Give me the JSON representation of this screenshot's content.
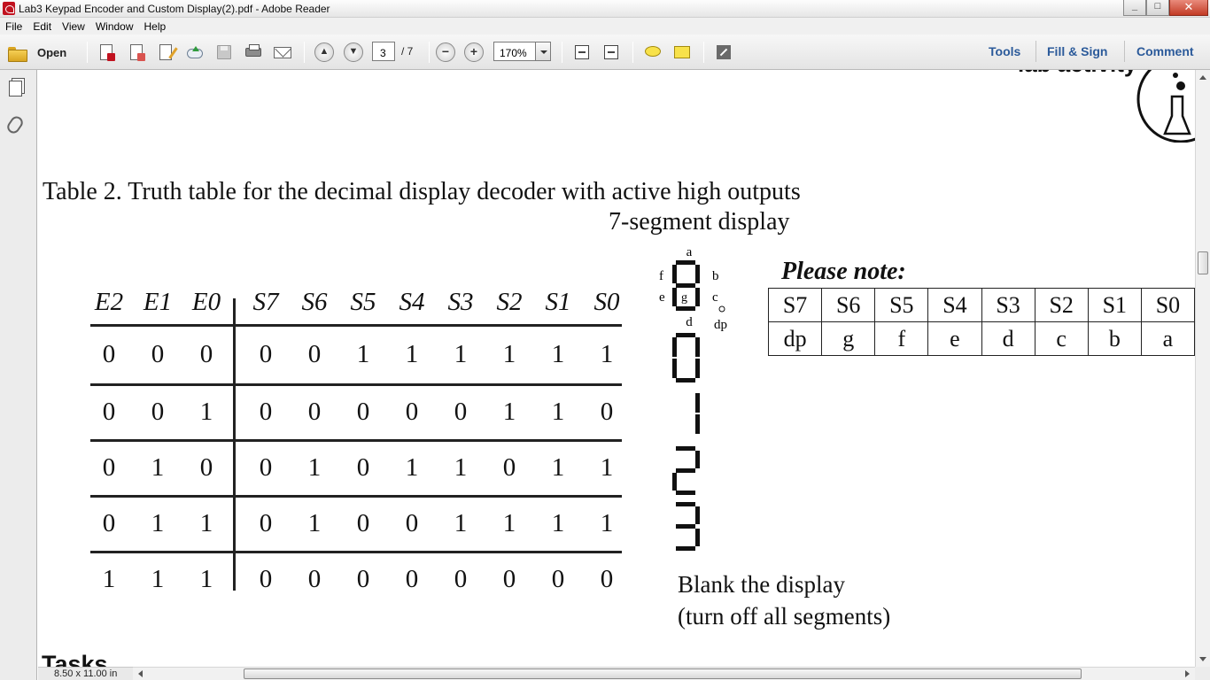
{
  "window": {
    "title": "Lab3 Keypad Encoder and Custom Display(2).pdf - Adobe Reader",
    "minimize_glyph": "_",
    "maximize_glyph": "□",
    "close_glyph": "✕"
  },
  "menu": [
    "File",
    "Edit",
    "View",
    "Window",
    "Help"
  ],
  "toolbar": {
    "open_label": "Open",
    "page_current": "3",
    "page_total": "/ 7",
    "zoom": "170%",
    "zoom_out_glyph": "−",
    "zoom_in_glyph": "+",
    "prev_glyph": "▲",
    "next_glyph": "▼",
    "links": [
      "Tools",
      "Fill & Sign",
      "Comment"
    ]
  },
  "document": {
    "top_fragment": "lab activity",
    "caption": "Table 2. Truth table for the decimal display decoder with active high outputs",
    "display_heading": "7-segment display",
    "seg_labels": {
      "a": "a",
      "b": "b",
      "c": "c",
      "d": "d",
      "e": "e",
      "f": "f",
      "g": "g",
      "dp": "dp"
    },
    "truth_table": {
      "input_headers": [
        "E2",
        "E1",
        "E0"
      ],
      "output_headers": [
        "S7",
        "S6",
        "S5",
        "S4",
        "S3",
        "S2",
        "S1",
        "S0"
      ],
      "rows": [
        {
          "inputs": [
            "0",
            "0",
            "0"
          ],
          "outputs": [
            "0",
            "0",
            "1",
            "1",
            "1",
            "1",
            "1",
            "1"
          ]
        },
        {
          "inputs": [
            "0",
            "0",
            "1"
          ],
          "outputs": [
            "0",
            "0",
            "0",
            "0",
            "0",
            "1",
            "1",
            "0"
          ]
        },
        {
          "inputs": [
            "0",
            "1",
            "0"
          ],
          "outputs": [
            "0",
            "1",
            "0",
            "1",
            "1",
            "0",
            "1",
            "1"
          ]
        },
        {
          "inputs": [
            "0",
            "1",
            "1"
          ],
          "outputs": [
            "0",
            "1",
            "0",
            "0",
            "1",
            "1",
            "1",
            "1"
          ]
        },
        {
          "inputs": [
            "1",
            "1",
            "1"
          ],
          "outputs": [
            "0",
            "0",
            "0",
            "0",
            "0",
            "0",
            "0",
            "0"
          ]
        }
      ]
    },
    "blank_note_line1": "Blank the display",
    "blank_note_line2": "(turn off all segments)",
    "note_title": "Please note:",
    "note_table": {
      "signals": [
        "S7",
        "S6",
        "S5",
        "S4",
        "S3",
        "S2",
        "S1",
        "S0"
      ],
      "segments": [
        "dp",
        "g",
        "f",
        "e",
        "d",
        "c",
        "b",
        "a"
      ]
    },
    "bottom_fragment": "Tasks"
  },
  "status": {
    "page_size": "8.50 x 11.00 in"
  }
}
